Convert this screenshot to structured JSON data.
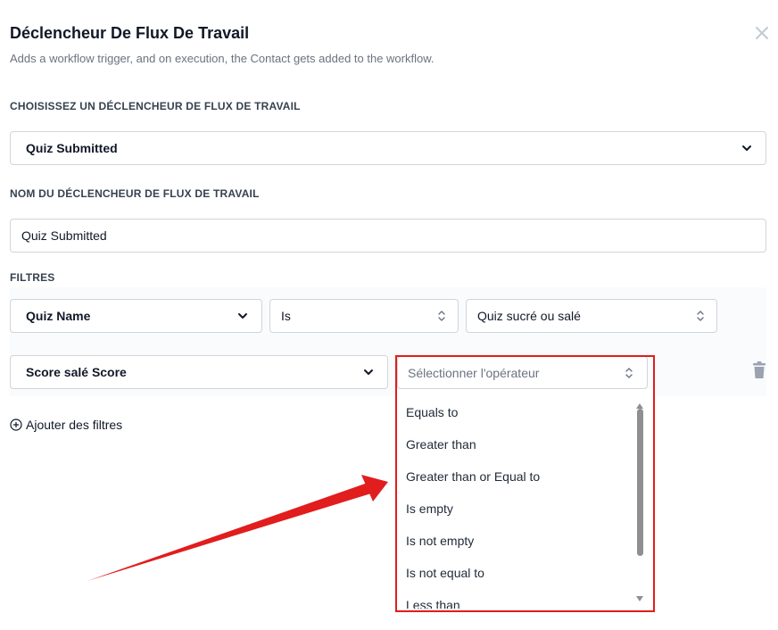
{
  "dialog": {
    "title": "Déclencheur De Flux De Travail",
    "subtitle": "Adds a workflow trigger, and on execution, the Contact gets added to the workflow."
  },
  "trigger_select": {
    "label": "CHOISISSEZ UN DÉCLENCHEUR DE FLUX DE TRAVAIL",
    "value": "Quiz Submitted"
  },
  "trigger_name": {
    "label": "NOM DU DÉCLENCHEUR DE FLUX DE TRAVAIL",
    "value": "Quiz Submitted"
  },
  "filters": {
    "label": "FILTRES",
    "row1": {
      "field": "Quiz Name",
      "operator": "Is",
      "value": "Quiz sucré ou salé"
    },
    "row2": {
      "field": "Score salé Score",
      "operator_placeholder": "Sélectionner l'opérateur"
    },
    "add_label": "Ajouter des filtres"
  },
  "operator_options": [
    "Equals to",
    "Greater than",
    "Greater than or Equal to",
    "Is empty",
    "Is not empty",
    "Is not equal to",
    "Less than"
  ],
  "icons": {
    "close": "close-icon",
    "chevron": "chevron-down-icon",
    "updown": "updown-arrows-icon",
    "trash": "trash-icon",
    "plus_circle": "plus-circle-icon"
  },
  "colors": {
    "annotation_red": "#e11d1d",
    "border": "#d1d5db",
    "muted_text": "#6b7280"
  }
}
